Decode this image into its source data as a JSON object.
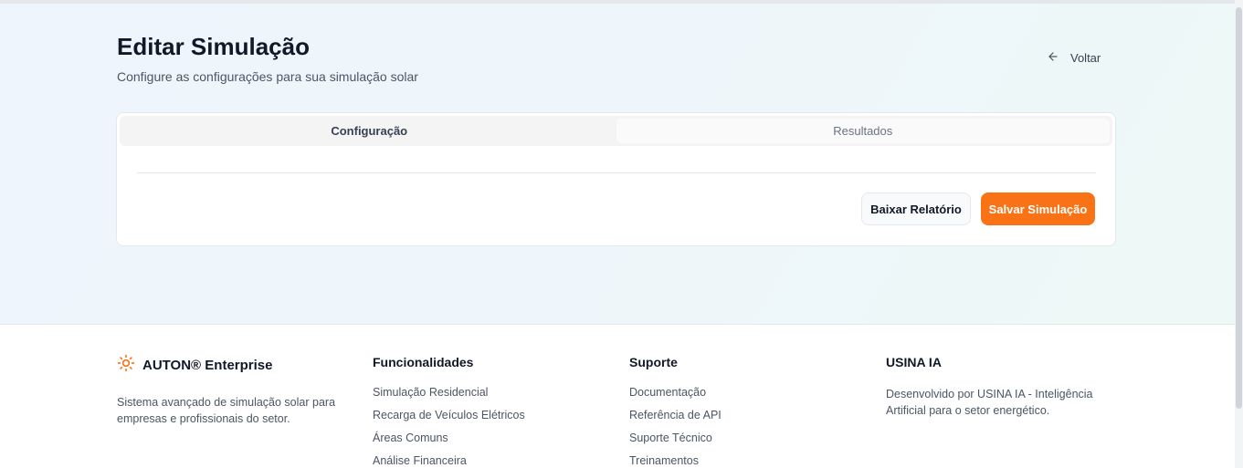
{
  "header": {
    "title": "Editar Simulação",
    "subtitle": "Configure as configurações para sua simulação solar",
    "back_label": "Voltar"
  },
  "tabs": [
    {
      "label": "Configuração",
      "active": true
    },
    {
      "label": "Resultados",
      "active": false
    }
  ],
  "actions": {
    "download_label": "Baixar Relatório",
    "save_label": "Salvar Simulação"
  },
  "footer": {
    "brand": {
      "name": "AUTON® Enterprise",
      "description": "Sistema avançado de simulação solar para empresas e profissionais do setor.",
      "icon": "sun-icon"
    },
    "features": {
      "title": "Funcionalidades",
      "items": [
        "Simulação Residencial",
        "Recarga de Veículos Elétricos",
        "Áreas Comuns",
        "Análise Financeira"
      ]
    },
    "support": {
      "title": "Suporte",
      "items": [
        "Documentação",
        "Referência de API",
        "Suporte Técnico",
        "Treinamentos"
      ]
    },
    "usina": {
      "title": "USINA IA",
      "description": "Desenvolvido por USINA IA - Inteligência Artificial para o setor energético."
    }
  },
  "colors": {
    "accent": "#f97316",
    "text": "#111827",
    "muted": "#4b5563"
  }
}
